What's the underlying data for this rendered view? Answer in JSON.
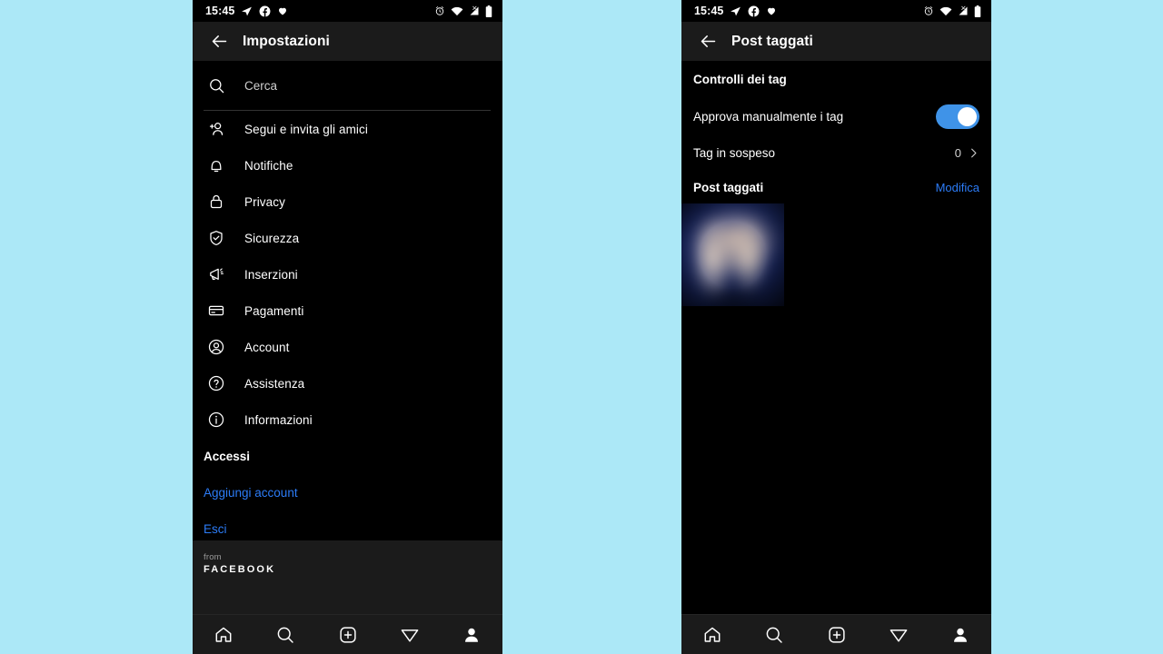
{
  "background_color": "#ace8f7",
  "accent_color": "#2c7cf7",
  "toggle_on_color": "#3f93e8",
  "status_bar": {
    "time": "15:45",
    "left_icons": [
      "telegram-icon",
      "facebook-icon",
      "heart-icon"
    ],
    "right_icons": [
      "alarm-icon",
      "wifi-icon",
      "cellular-signal-off-icon",
      "battery-icon"
    ]
  },
  "left_phone": {
    "appbar": {
      "title": "Impostazioni",
      "back_icon": "arrow-left-icon"
    },
    "search": {
      "placeholder": "Cerca",
      "icon": "search-icon"
    },
    "menu_items": [
      {
        "icon": "add-person-icon",
        "label": "Segui e invita gli amici"
      },
      {
        "icon": "bell-icon",
        "label": "Notifiche"
      },
      {
        "icon": "lock-icon",
        "label": "Privacy"
      },
      {
        "icon": "shield-check-icon",
        "label": "Sicurezza"
      },
      {
        "icon": "megaphone-icon",
        "label": "Inserzioni"
      },
      {
        "icon": "credit-card-icon",
        "label": "Pagamenti"
      },
      {
        "icon": "account-circle-icon",
        "label": "Account"
      },
      {
        "icon": "help-circle-icon",
        "label": "Assistenza"
      },
      {
        "icon": "info-circle-icon",
        "label": "Informazioni"
      }
    ],
    "section_header": "Accessi",
    "links": [
      {
        "label": "Aggiungi account"
      },
      {
        "label": "Esci"
      }
    ],
    "footer": {
      "from": "from",
      "brand": "FACEBOOK"
    }
  },
  "right_phone": {
    "appbar": {
      "title": "Post taggati",
      "back_icon": "arrow-left-icon"
    },
    "group_title": "Controlli dei tag",
    "toggle_row": {
      "label": "Approva manualmente i tag",
      "state": "on"
    },
    "pending_row": {
      "label": "Tag in sospeso",
      "value": "0",
      "chevron": "chevron-right-icon"
    },
    "posts_section": {
      "title": "Post taggati",
      "action": "Modifica"
    },
    "thumbnails": [
      {
        "alt": "tagged-post-thumbnail"
      }
    ]
  },
  "tab_bar": {
    "tabs": [
      {
        "icon": "home-icon",
        "name": "home"
      },
      {
        "icon": "search-icon",
        "name": "search"
      },
      {
        "icon": "add-square-icon",
        "name": "create"
      },
      {
        "icon": "paper-plane-icon",
        "name": "reels"
      },
      {
        "icon": "profile-icon",
        "name": "profile"
      }
    ]
  }
}
